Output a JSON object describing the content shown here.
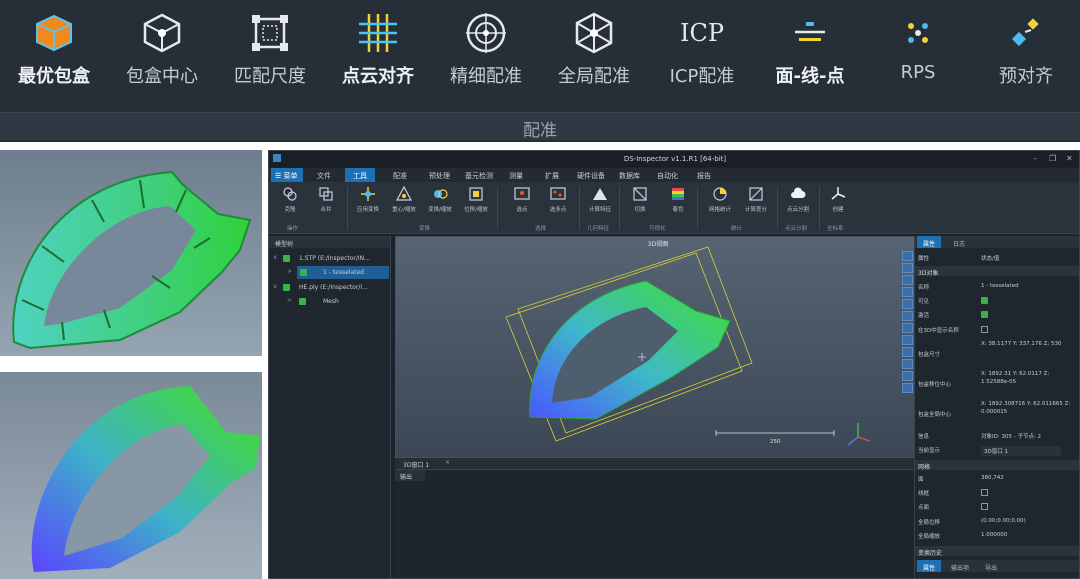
{
  "banner": {
    "tools": [
      {
        "label": "最优包盒",
        "icon": "orange-box-icon"
      },
      {
        "label": "包盒中心",
        "icon": "box-center-icon"
      },
      {
        "label": "匹配尺度",
        "icon": "match-scale-icon"
      },
      {
        "label": "点云对齐",
        "icon": "point-cloud-align-icon"
      },
      {
        "label": "精细配准",
        "icon": "fine-registration-icon"
      },
      {
        "label": "全局配准",
        "icon": "global-registration-icon"
      },
      {
        "label": "ICP配准",
        "icon_text": "ICP"
      },
      {
        "label": "面-线-点",
        "icon": "plane-line-point-icon"
      },
      {
        "label": "RPS",
        "icon": "rps-icon"
      },
      {
        "label": "预对齐",
        "icon": "pre-align-icon"
      }
    ],
    "group_label": "配准"
  },
  "app": {
    "title": "DS-Inspector v1.1.R1 [64-bit]",
    "menu_button": "菜单",
    "menu": [
      "文件",
      "工具",
      "配准",
      "预处理",
      "基元检测",
      "测量",
      "扩展",
      "硬件设备",
      "数据库",
      "自动化",
      "报告"
    ],
    "ribbon": {
      "buttons": [
        "克隆",
        "合并",
        "应用变换",
        "重心/缩放",
        "变换/缩放",
        "位移/缩放",
        "选点",
        "选多点",
        "计算特征",
        "切换",
        "着色",
        "网格统计",
        "计算差分",
        "点云分割",
        "创建"
      ],
      "groups": [
        "操作",
        "变换",
        "选择",
        "几何特征",
        "可视化",
        "统计",
        "点云分割",
        "坐标系"
      ]
    },
    "tree": {
      "header": "模型树",
      "items": [
        {
          "label": "1.STP (E:/Inspector/IN...",
          "level": 0
        },
        {
          "label": "1 - tesselated",
          "level": 1,
          "selected": true
        },
        {
          "label": "HE.ply (E:/Inspector/I...",
          "level": 0
        },
        {
          "label": "Mesh",
          "level": 1
        }
      ]
    },
    "viewport": {
      "title": "3D视图",
      "scale_value": "250",
      "tab": "3D窗口 1"
    },
    "output": {
      "header": "输出"
    },
    "props": {
      "tabs": [
        "属性",
        "日志"
      ],
      "header_k": "属性",
      "header_v": "状态/值",
      "section1": "3D对象",
      "rows": [
        {
          "k": "名称",
          "v": "1 - tesselated"
        },
        {
          "k": "可见",
          "check": true
        },
        {
          "k": "激活",
          "check": true
        },
        {
          "k": "在3D中显示名称",
          "check": false
        },
        {
          "k": "包盒尺寸",
          "v": "X: 38.1177 Y: 337.176 Z: 530"
        },
        {
          "k": "包盒移位中心",
          "v": "X: 1892.31 Y: 62.0117 Z: 1.52588e-05"
        },
        {
          "k": "包盒全局中心",
          "v": "X: 1892.308716 Y: 62.011665 Z: 0.000015"
        },
        {
          "k": "信息",
          "v": "对象ID: 305 - 子节点: 2"
        },
        {
          "k": "当前显示",
          "v": "3D窗口 1"
        }
      ],
      "section2": "网格",
      "rows2": [
        {
          "k": "面",
          "v": "380,742"
        },
        {
          "k": "线框",
          "check": false
        },
        {
          "k": "点面",
          "check": false
        },
        {
          "k": "全局位移",
          "v": "(0.00;0.00;0.00)"
        },
        {
          "k": "全局缩放",
          "v": "1.000000"
        }
      ],
      "section3": "变换历史",
      "bottom_tabs": [
        "属性",
        "输出项",
        "导出"
      ]
    }
  }
}
